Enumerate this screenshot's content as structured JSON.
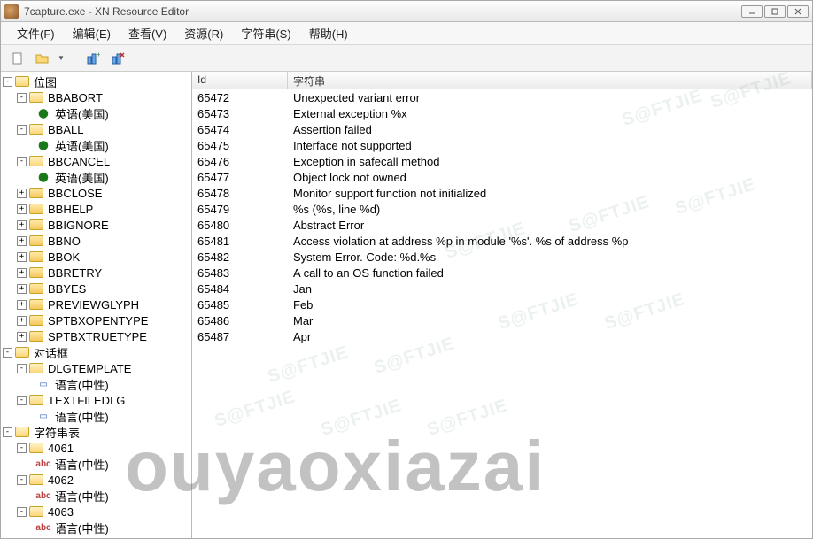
{
  "window": {
    "title": "7capture.exe - XN Resource Editor"
  },
  "menu": {
    "file": "文件(F)",
    "edit": "编辑(E)",
    "view": "查看(V)",
    "resource": "资源(R)",
    "string": "字符串(S)",
    "help": "帮助(H)"
  },
  "toolbar": {
    "new": "new",
    "open": "open",
    "addres": "add-resource",
    "delres": "del-resource"
  },
  "tree": {
    "bitmap": {
      "label": "位图",
      "BBABORT": {
        "label": "BBABORT",
        "lang": "英语(美国)"
      },
      "BBALL": {
        "label": "BBALL",
        "lang": "英语(美国)"
      },
      "BBCANCEL": {
        "label": "BBCANCEL",
        "lang": "英语(美国)"
      },
      "BBCLOSE": {
        "label": "BBCLOSE"
      },
      "BBHELP": {
        "label": "BBHELP"
      },
      "BBIGNORE": {
        "label": "BBIGNORE"
      },
      "BBNO": {
        "label": "BBNO"
      },
      "BBOK": {
        "label": "BBOK"
      },
      "BBRETRY": {
        "label": "BBRETRY"
      },
      "BBYES": {
        "label": "BBYES"
      },
      "PREVIEWGLYPH": {
        "label": "PREVIEWGLYPH"
      },
      "SPTBXOPENTYPE": {
        "label": "SPTBXOPENTYPE"
      },
      "SPTBXTRUETYPE": {
        "label": "SPTBXTRUETYPE"
      }
    },
    "dialog": {
      "label": "对话框",
      "DLGTEMPLATE": {
        "label": "DLGTEMPLATE",
        "lang": "语言(中性)"
      },
      "TEXTFILEDLG": {
        "label": "TEXTFILEDLG",
        "lang": "语言(中性)"
      }
    },
    "stringtable": {
      "label": "字符串表",
      "g4061": {
        "label": "4061",
        "lang": "语言(中性)"
      },
      "g4062": {
        "label": "4062",
        "lang": "语言(中性)"
      },
      "g4063": {
        "label": "4063",
        "lang": "语言(中性)"
      }
    }
  },
  "list": {
    "header_id": "Id",
    "header_str": "字符串",
    "rows": [
      {
        "id": "65472",
        "str": "Unexpected variant error"
      },
      {
        "id": "65473",
        "str": "External exception %x"
      },
      {
        "id": "65474",
        "str": "Assertion failed"
      },
      {
        "id": "65475",
        "str": "Interface not supported"
      },
      {
        "id": "65476",
        "str": "Exception in safecall method"
      },
      {
        "id": "65477",
        "str": "Object lock not owned"
      },
      {
        "id": "65478",
        "str": "Monitor support function not initialized"
      },
      {
        "id": "65479",
        "str": "%s (%s, line %d)"
      },
      {
        "id": "65480",
        "str": "Abstract Error"
      },
      {
        "id": "65481",
        "str": "Access violation at address %p in module '%s'. %s of address %p"
      },
      {
        "id": "65482",
        "str": "System Error.  Code: %d.%s"
      },
      {
        "id": "65483",
        "str": "A call to an OS function failed"
      },
      {
        "id": "65484",
        "str": "Jan"
      },
      {
        "id": "65485",
        "str": "Feb"
      },
      {
        "id": "65486",
        "str": "Mar"
      },
      {
        "id": "65487",
        "str": "Apr"
      }
    ]
  },
  "watermark": {
    "big": "ouyaoxiazai",
    "diag": "S@FTJIE"
  }
}
